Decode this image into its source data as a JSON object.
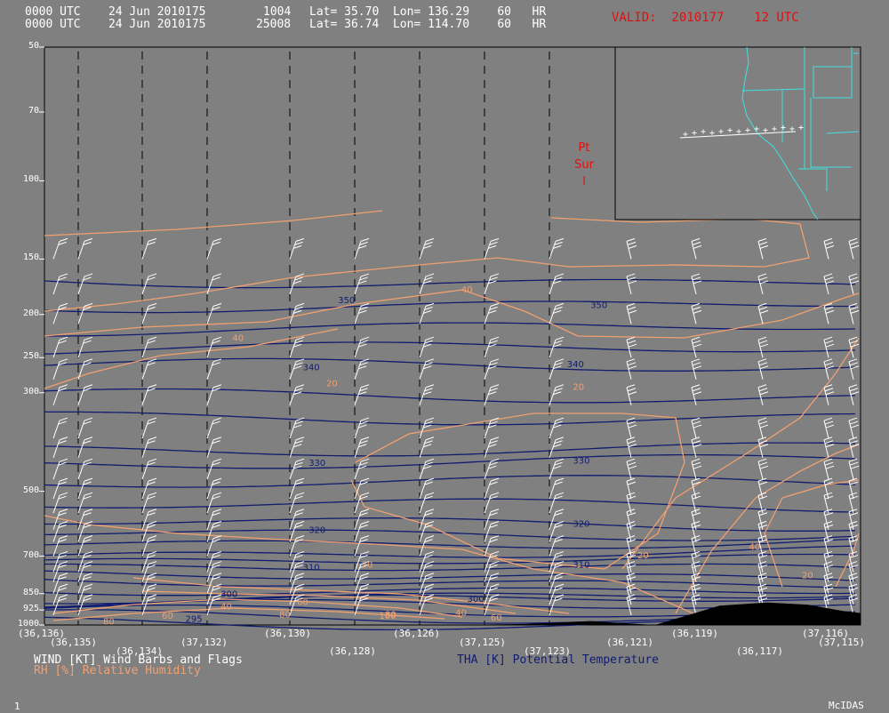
{
  "header": {
    "line1": {
      "time": "0000 UTC",
      "date": "24 Jun 2010175",
      "station": "1004",
      "lat_label": "Lat=",
      "lat": "35.70",
      "lon_label": "Lon=",
      "lon": "136.29",
      "fcst": "60",
      "unit": "HR"
    },
    "line2": {
      "time": "0000 UTC",
      "date": "24 Jun 2010175",
      "station": "25008",
      "lat_label": "Lat=",
      "lat": "36.74",
      "lon_label": "Lon=",
      "lon": "114.70",
      "fcst": "60",
      "unit": "HR"
    },
    "valid": "VALID:  2010177    12 UTC"
  },
  "annotation": {
    "line1": "Pt",
    "line2": "Sur",
    "line3": "l"
  },
  "legend": {
    "wind": "WIND [KT] Wind Barbs and Flags",
    "rh": "RH [%] Relative Humidity",
    "theta": "THA [K] Potential Temperature"
  },
  "footer": {
    "left": "1",
    "right": "McIDAS"
  },
  "colors": {
    "background": "#808080",
    "theta": "#101c6e",
    "rh": "#f0a070",
    "wind": "#ffffff",
    "terrain": "#000000",
    "map": "#40e0e0",
    "valid": "#e01010"
  },
  "chart_data": {
    "type": "cross-section",
    "y_axis": {
      "label": "",
      "ticks": [
        50,
        70,
        100,
        150,
        200,
        250,
        300,
        500,
        700,
        850,
        925,
        1000
      ],
      "scale": "log-pressure",
      "range": [
        1000,
        50
      ]
    },
    "x_axis_labels": [
      "(36,136)",
      "(36,135)",
      "(36,134)",
      "(37,132)",
      "(36,130)",
      "(36,128)",
      "(36,126)",
      "(37,125)",
      "(37,123)",
      "(36,121)",
      "(36,119)",
      "(36,117)",
      "(37,116)",
      "(37,115)"
    ],
    "theta_contour_labels": [
      {
        "value": "350",
        "x_index": 5.0,
        "p": 185
      },
      {
        "value": "350",
        "x_index": 9.3,
        "p": 190
      },
      {
        "value": "340",
        "x_index": 4.4,
        "p": 262
      },
      {
        "value": "340",
        "x_index": 8.9,
        "p": 258
      },
      {
        "value": "330",
        "x_index": 4.5,
        "p": 430
      },
      {
        "value": "330",
        "x_index": 9.0,
        "p": 425
      },
      {
        "value": "320",
        "x_index": 4.5,
        "p": 610
      },
      {
        "value": "320",
        "x_index": 9.0,
        "p": 590
      },
      {
        "value": "310",
        "x_index": 4.4,
        "p": 740
      },
      {
        "value": "310",
        "x_index": 9.0,
        "p": 730
      },
      {
        "value": "300",
        "x_index": 3.0,
        "p": 850
      },
      {
        "value": "300",
        "x_index": 7.2,
        "p": 870
      },
      {
        "value": "295",
        "x_index": 2.4,
        "p": 965
      }
    ],
    "rh_contour_labels": [
      {
        "value": "40",
        "x_index": 7.1,
        "p": 175
      },
      {
        "value": "40",
        "x_index": 3.2,
        "p": 225
      },
      {
        "value": "20",
        "x_index": 4.8,
        "p": 285
      },
      {
        "value": "20",
        "x_index": 9.0,
        "p": 290
      },
      {
        "value": "20",
        "x_index": 5.4,
        "p": 730
      },
      {
        "value": "20",
        "x_index": 10.1,
        "p": 695
      },
      {
        "value": "40",
        "x_index": 12.0,
        "p": 665
      },
      {
        "value": "20",
        "x_index": 12.9,
        "p": 770
      },
      {
        "value": "60",
        "x_index": 4.3,
        "p": 885
      },
      {
        "value": "40",
        "x_index": 3.0,
        "p": 905
      },
      {
        "value": "80",
        "x_index": 4.0,
        "p": 945
      },
      {
        "value": "60",
        "x_index": 2.0,
        "p": 950
      },
      {
        "value": "80",
        "x_index": 1.0,
        "p": 980
      },
      {
        "value": "80",
        "x_index": 5.8,
        "p": 945
      },
      {
        "value": "40",
        "x_index": 7.0,
        "p": 935
      },
      {
        "value": "60",
        "x_index": 7.6,
        "p": 960
      },
      {
        "value": "100",
        "x_index": 5.7,
        "p": 950
      }
    ],
    "terrain": [
      [
        0,
        1000
      ],
      [
        7.0,
        1000
      ],
      [
        8.2,
        995
      ],
      [
        9.3,
        980
      ],
      [
        10.1,
        995
      ],
      [
        10.4,
        1000
      ],
      [
        11.5,
        905
      ],
      [
        12.3,
        890
      ],
      [
        13.0,
        900
      ],
      [
        13.6,
        930
      ],
      [
        13.9,
        940
      ],
      [
        13.9,
        1000
      ]
    ],
    "grid": "dashed vertical lines",
    "inset": "western US map with section path"
  }
}
